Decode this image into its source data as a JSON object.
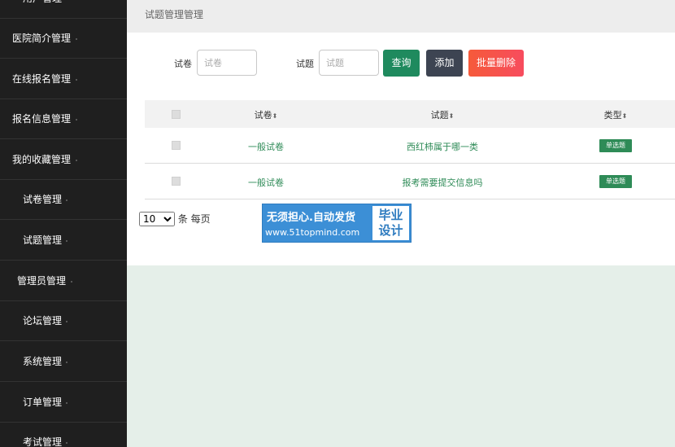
{
  "sidebar": {
    "items": [
      {
        "label": "用户管理"
      },
      {
        "label": "医院简介管理"
      },
      {
        "label": "在线报名管理"
      },
      {
        "label": "报名信息管理"
      },
      {
        "label": "我的收藏管理"
      },
      {
        "label": "试卷管理"
      },
      {
        "label": "试题管理"
      },
      {
        "label": "管理员管理"
      },
      {
        "label": "论坛管理"
      },
      {
        "label": "系统管理"
      },
      {
        "label": "订单管理"
      },
      {
        "label": "考试管理"
      }
    ]
  },
  "breadcrumb": "试题管理管理",
  "filters": {
    "paper_label": "试卷",
    "paper_placeholder": "试卷",
    "question_label": "试题",
    "question_placeholder": "试题"
  },
  "buttons": {
    "query": "查询",
    "add": "添加",
    "batch_delete": "批量删除"
  },
  "table": {
    "headers": {
      "paper": "试卷",
      "question": "试题",
      "type": "类型"
    },
    "sort_glyph": "⬍",
    "rows": [
      {
        "paper": "一般试卷",
        "question": "西红柿属于哪一类",
        "type": "单选题"
      },
      {
        "paper": "一般试卷",
        "question": "报考需要提交信息吗",
        "type": "单选题"
      }
    ]
  },
  "pagination": {
    "page_size": "10",
    "suffix": "条 每页"
  },
  "promo": {
    "line1": "无须担心.自动发货",
    "line2": "www.51topmind.com",
    "right_line1": "毕业",
    "right_line2": "设计"
  },
  "colors": {
    "sidebar_bg": "#1f1f1f",
    "query_btn": "#1f8a5e",
    "add_btn": "#3d4452",
    "delete_btn": "#f5543c",
    "accent_green": "#2e8b57",
    "promo_blue": "#3c8fd6"
  }
}
